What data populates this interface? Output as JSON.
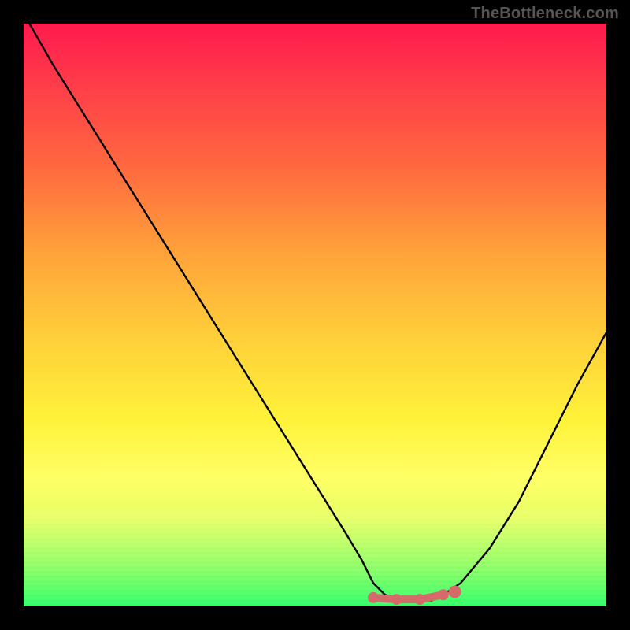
{
  "watermark": "TheBottleneck.com",
  "chart_data": {
    "type": "line",
    "title": "",
    "xlabel": "",
    "ylabel": "",
    "xlim": [
      0,
      100
    ],
    "ylim": [
      0,
      100
    ],
    "background_gradient": {
      "top": "#ff1a4d",
      "mid_high": "#ffa53a",
      "mid": "#fff23a",
      "mid_low": "#e6ff66",
      "bottom": "#33ff66"
    },
    "series": [
      {
        "name": "bottleneck-curve",
        "color": "#000000",
        "x": [
          1,
          5,
          10,
          15,
          20,
          25,
          30,
          35,
          40,
          45,
          50,
          55,
          58,
          60,
          62,
          65,
          68,
          70,
          72,
          75,
          80,
          85,
          90,
          95,
          100
        ],
        "y": [
          100,
          93,
          85,
          77,
          69,
          61,
          53,
          45,
          37,
          29,
          21,
          13,
          8,
          4,
          2,
          1,
          1,
          1,
          2,
          4,
          10,
          18,
          28,
          38,
          47
        ]
      }
    ],
    "markers": [
      {
        "name": "valley-range-left",
        "x": 60,
        "y": 1.5,
        "color": "#d46a6a",
        "size": 7
      },
      {
        "name": "valley-range-mid1",
        "x": 64,
        "y": 1.2,
        "color": "#d46a6a",
        "size": 7
      },
      {
        "name": "valley-range-mid2",
        "x": 68,
        "y": 1.2,
        "color": "#d46a6a",
        "size": 7
      },
      {
        "name": "valley-range-right",
        "x": 72,
        "y": 2.0,
        "color": "#d46a6a",
        "size": 7
      },
      {
        "name": "valley-dot",
        "x": 74,
        "y": 2.5,
        "color": "#d46a6a",
        "size": 8
      }
    ]
  }
}
